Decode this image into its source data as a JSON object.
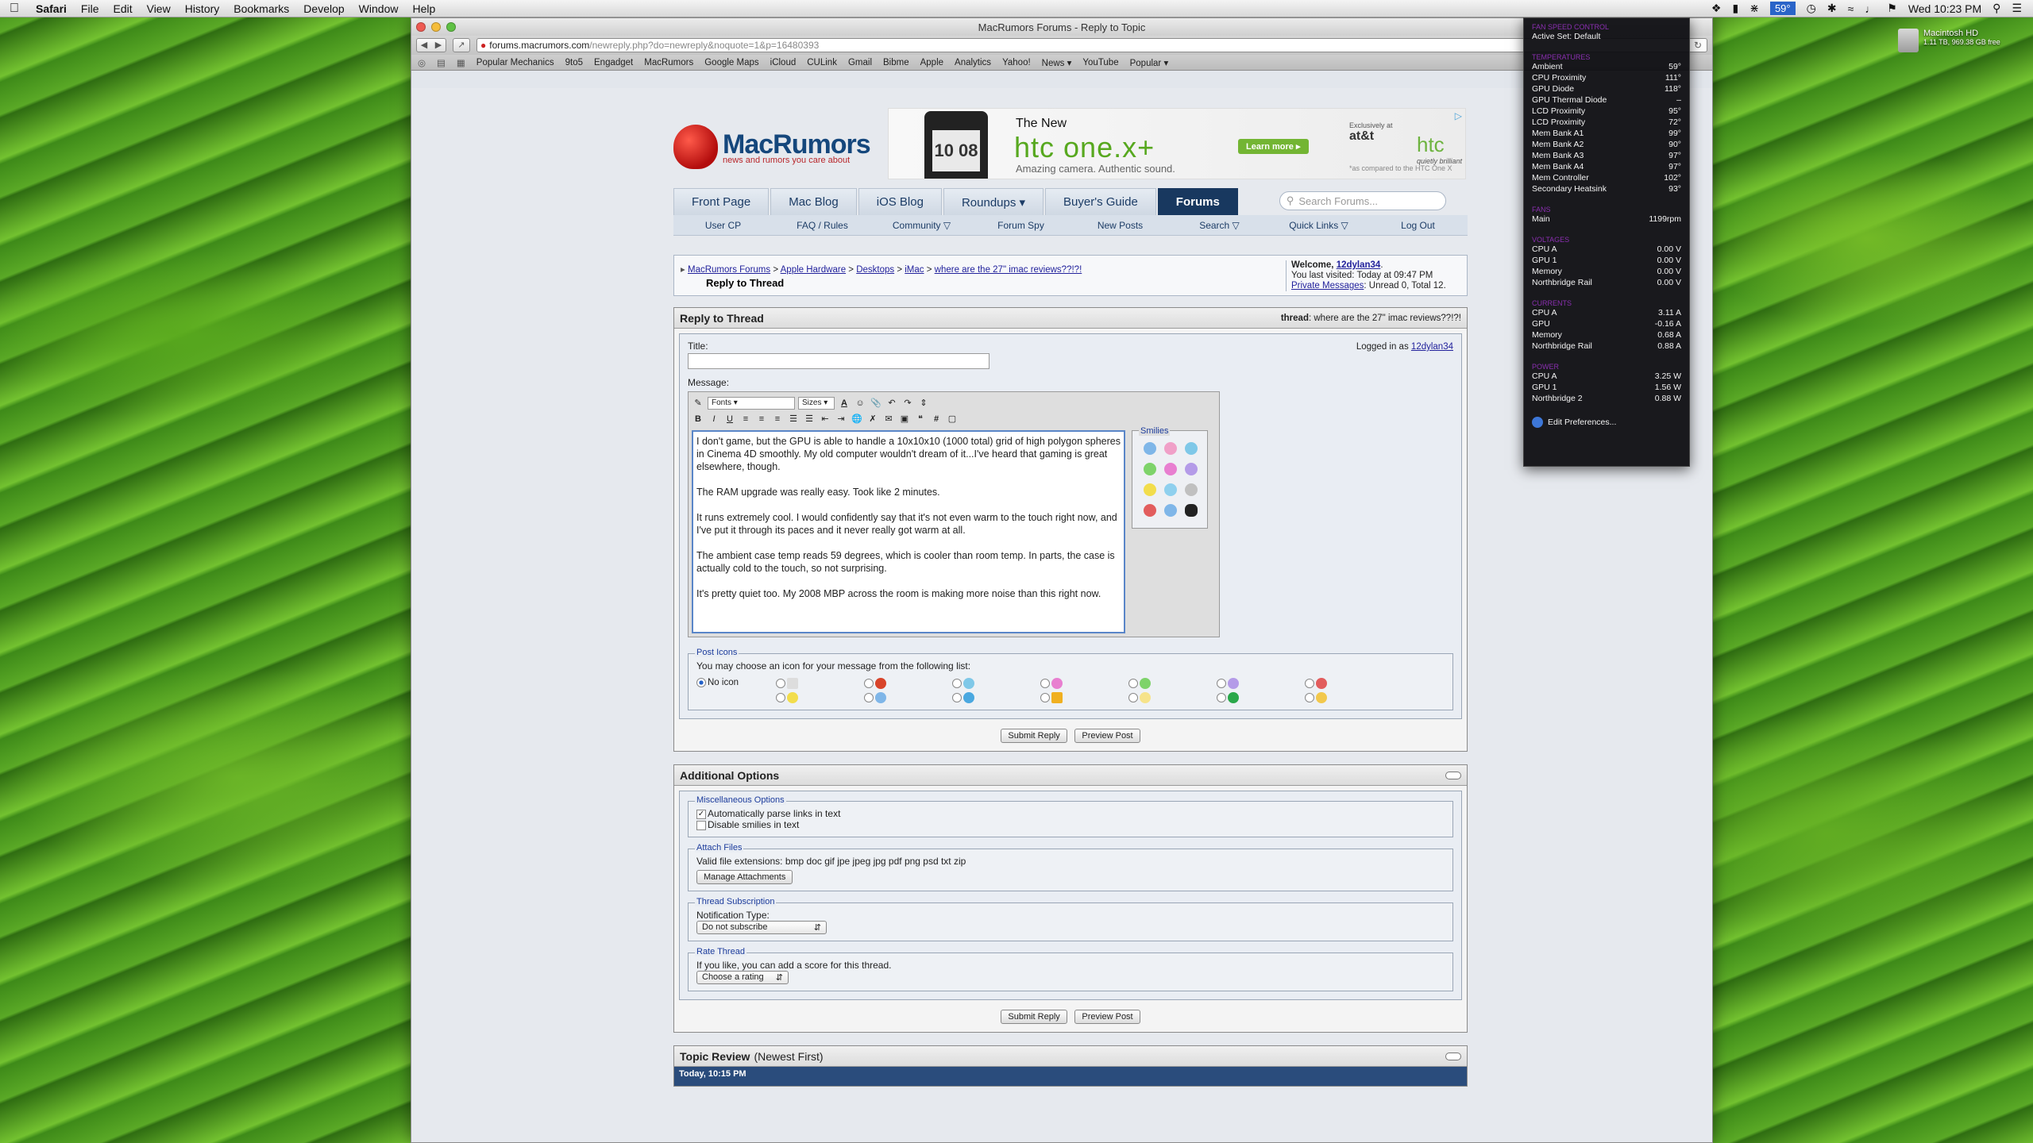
{
  "menubar": {
    "app": "Safari",
    "menus": [
      "File",
      "Edit",
      "View",
      "History",
      "Bookmarks",
      "Develop",
      "Window",
      "Help"
    ],
    "temp_badge": "59°",
    "clock": "Wed 10:23 PM"
  },
  "window": {
    "title": "MacRumors Forums - Reply to Topic",
    "url_host": "forums.macrumors.com",
    "url_path": "/newreply.php?do=newreply&noquote=1&p=16480393",
    "bookmarks": [
      "Popular Mechanics",
      "9to5",
      "Engadget",
      "MacRumors",
      "Google Maps",
      "iCloud",
      "CULink",
      "Gmail",
      "Bibme",
      "Apple",
      "Analytics",
      "Yahoo!",
      "News ▾",
      "YouTube",
      "Popular ▾"
    ]
  },
  "site": {
    "brand": "MacRumors",
    "tagline": "news and rumors you care about",
    "ad": {
      "new_text": "The New",
      "product": "htc one.x+",
      "slogan": "Amazing camera. Authentic sound.",
      "learn": "Learn more ▸",
      "exclusive": "Exclusively at",
      "att": "at&t",
      "htc_logo": "htc",
      "htc_tagline": "quietly brilliant",
      "fine": "*as compared to the HTC One X",
      "phone_time": "10 08"
    },
    "nav": [
      "Front Page",
      "Mac Blog",
      "iOS Blog",
      "Roundups ▾",
      "Buyer's Guide",
      "Forums"
    ],
    "search_placeholder": "Search Forums...",
    "subnav": [
      "User CP",
      "FAQ / Rules",
      "Community ▽",
      "Forum Spy",
      "New Posts",
      "Search ▽",
      "Quick Links ▽",
      "Log Out"
    ]
  },
  "breadcrumb": {
    "items": [
      "MacRumors Forums",
      "Apple Hardware",
      "Desktops",
      "iMac",
      "where are the 27\" imac reviews??!?!"
    ],
    "current": "Reply to Thread",
    "welcome_label": "Welcome,",
    "username": "12dylan34",
    "last_visited": "You last visited: Today at 09:47 PM",
    "pm_link": "Private Messages",
    "pm_status": ": Unread 0, Total 12."
  },
  "reply": {
    "heading": "Reply to Thread",
    "thread_label": "thread",
    "thread_title": ": where are the 27\" imac reviews??!?!",
    "title_label": "Title:",
    "logged_in_label": "Logged in as",
    "logged_in_user": "12dylan34",
    "message_label": "Message:",
    "fonts": "Fonts",
    "sizes": "Sizes",
    "paragraphs": [
      "I don't game, but the GPU is able to handle a 10x10x10 (1000 total) grid of high polygon spheres in Cinema 4D smoothly. My old computer wouldn't dream of it...I've heard that gaming is great elsewhere, though.",
      "The RAM upgrade was really easy. Took like 2 minutes.",
      "It runs extremely cool. I would confidently say that it's not even warm to the touch right now, and I've put it through its paces and it never really got warm at all.",
      "The ambient case temp reads 59 degrees, which is cooler than room temp. In parts, the case is actually cold to the touch, so not surprising.",
      "It's pretty quiet too. My 2008 MBP across the room is making more noise than this right now."
    ],
    "smilies_label": "Smilies",
    "post_icons_label": "Post Icons",
    "post_icons_hint": "You may choose an icon for your message from the following list:",
    "no_icon": "No icon",
    "submit": "Submit Reply",
    "preview": "Preview Post"
  },
  "additional": {
    "heading": "Additional Options",
    "misc_label": "Miscellaneous Options",
    "parse_links": "Automatically parse links in text",
    "disable_smilies": "Disable smilies in text",
    "attach_label": "Attach Files",
    "extensions": "Valid file extensions: bmp doc gif jpe jpeg jpg pdf png psd txt zip",
    "manage": "Manage Attachments",
    "subscription_label": "Thread Subscription",
    "notification_label": "Notification Type:",
    "notification_value": "Do not subscribe",
    "rate_label": "Rate Thread",
    "rate_hint": "If you like, you can add a score for this thread.",
    "rate_value": "Choose a rating",
    "submit": "Submit Reply",
    "preview": "Preview Post"
  },
  "topic_review": {
    "heading": "Topic Review",
    "sub": "(Newest First)",
    "first_row": "Today, 10:15 PM"
  },
  "temps": {
    "header": "FAN SPEED CONTROL",
    "active_set_label": "Active Set:",
    "active_set": "Default",
    "sections": [
      {
        "name": "TEMPERATURES",
        "rows": [
          [
            "Ambient",
            "59°"
          ],
          [
            "CPU Proximity",
            "111°"
          ],
          [
            "GPU Diode",
            "118°"
          ],
          [
            "GPU Thermal Diode",
            "–"
          ],
          [
            "LCD Proximity",
            "95°"
          ],
          [
            "LCD Proximity",
            "72°"
          ],
          [
            "Mem Bank A1",
            "99°"
          ],
          [
            "Mem Bank A2",
            "90°"
          ],
          [
            "Mem Bank A3",
            "97°"
          ],
          [
            "Mem Bank A4",
            "97°"
          ],
          [
            "Mem Controller",
            "102°"
          ],
          [
            "Secondary Heatsink",
            "93°"
          ]
        ]
      },
      {
        "name": "FANS",
        "rows": [
          [
            "Main",
            "1199rpm"
          ]
        ]
      },
      {
        "name": "VOLTAGES",
        "rows": [
          [
            "CPU A",
            "0.00 V"
          ],
          [
            "GPU 1",
            "0.00 V"
          ],
          [
            "Memory",
            "0.00 V"
          ],
          [
            "Northbridge Rail",
            "0.00 V"
          ]
        ]
      },
      {
        "name": "CURRENTS",
        "rows": [
          [
            "CPU A",
            "3.11 A"
          ],
          [
            "GPU",
            "-0.16 A"
          ],
          [
            "Memory",
            "0.68 A"
          ],
          [
            "Northbridge Rail",
            "0.88 A"
          ]
        ]
      },
      {
        "name": "POWER",
        "rows": [
          [
            "CPU A",
            "3.25 W"
          ],
          [
            "GPU 1",
            "1.56 W"
          ],
          [
            "Northbridge 2",
            "0.88 W"
          ]
        ]
      }
    ],
    "prefs": "Edit Preferences..."
  },
  "desktop": {
    "disk_name": "Macintosh HD",
    "disk_info": "1.11 TB, 969.38 GB free"
  }
}
